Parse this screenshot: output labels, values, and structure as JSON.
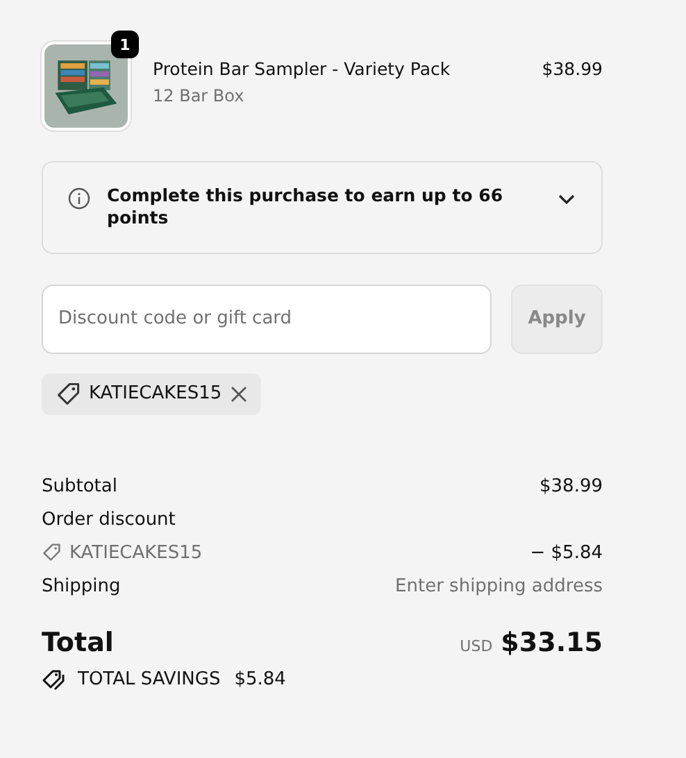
{
  "product": {
    "quantity": "1",
    "name": "Protein Bar Sampler - Variety Pack",
    "variant": "12 Bar Box",
    "price": "$38.99"
  },
  "points_notice": {
    "text": "Complete this purchase to earn up to 66 points",
    "expanded": false
  },
  "discount": {
    "placeholder": "Discount code or gift card",
    "button": "Apply",
    "disabled": true
  },
  "applied_codes": [
    "KATIECAKES15"
  ],
  "summary": [
    {
      "kind": "line",
      "label": "Subtotal",
      "value": "$38.99"
    },
    {
      "kind": "heading",
      "label": "Order discount"
    },
    {
      "kind": "code",
      "label": "KATIECAKES15",
      "value": "− $5.84"
    },
    {
      "kind": "muted",
      "label": "Shipping",
      "value": "Enter shipping address"
    }
  ],
  "total": {
    "label": "Total",
    "currency": "USD",
    "value": "$33.15"
  },
  "savings": {
    "label": "TOTAL SAVINGS",
    "value": "$5.84"
  }
}
